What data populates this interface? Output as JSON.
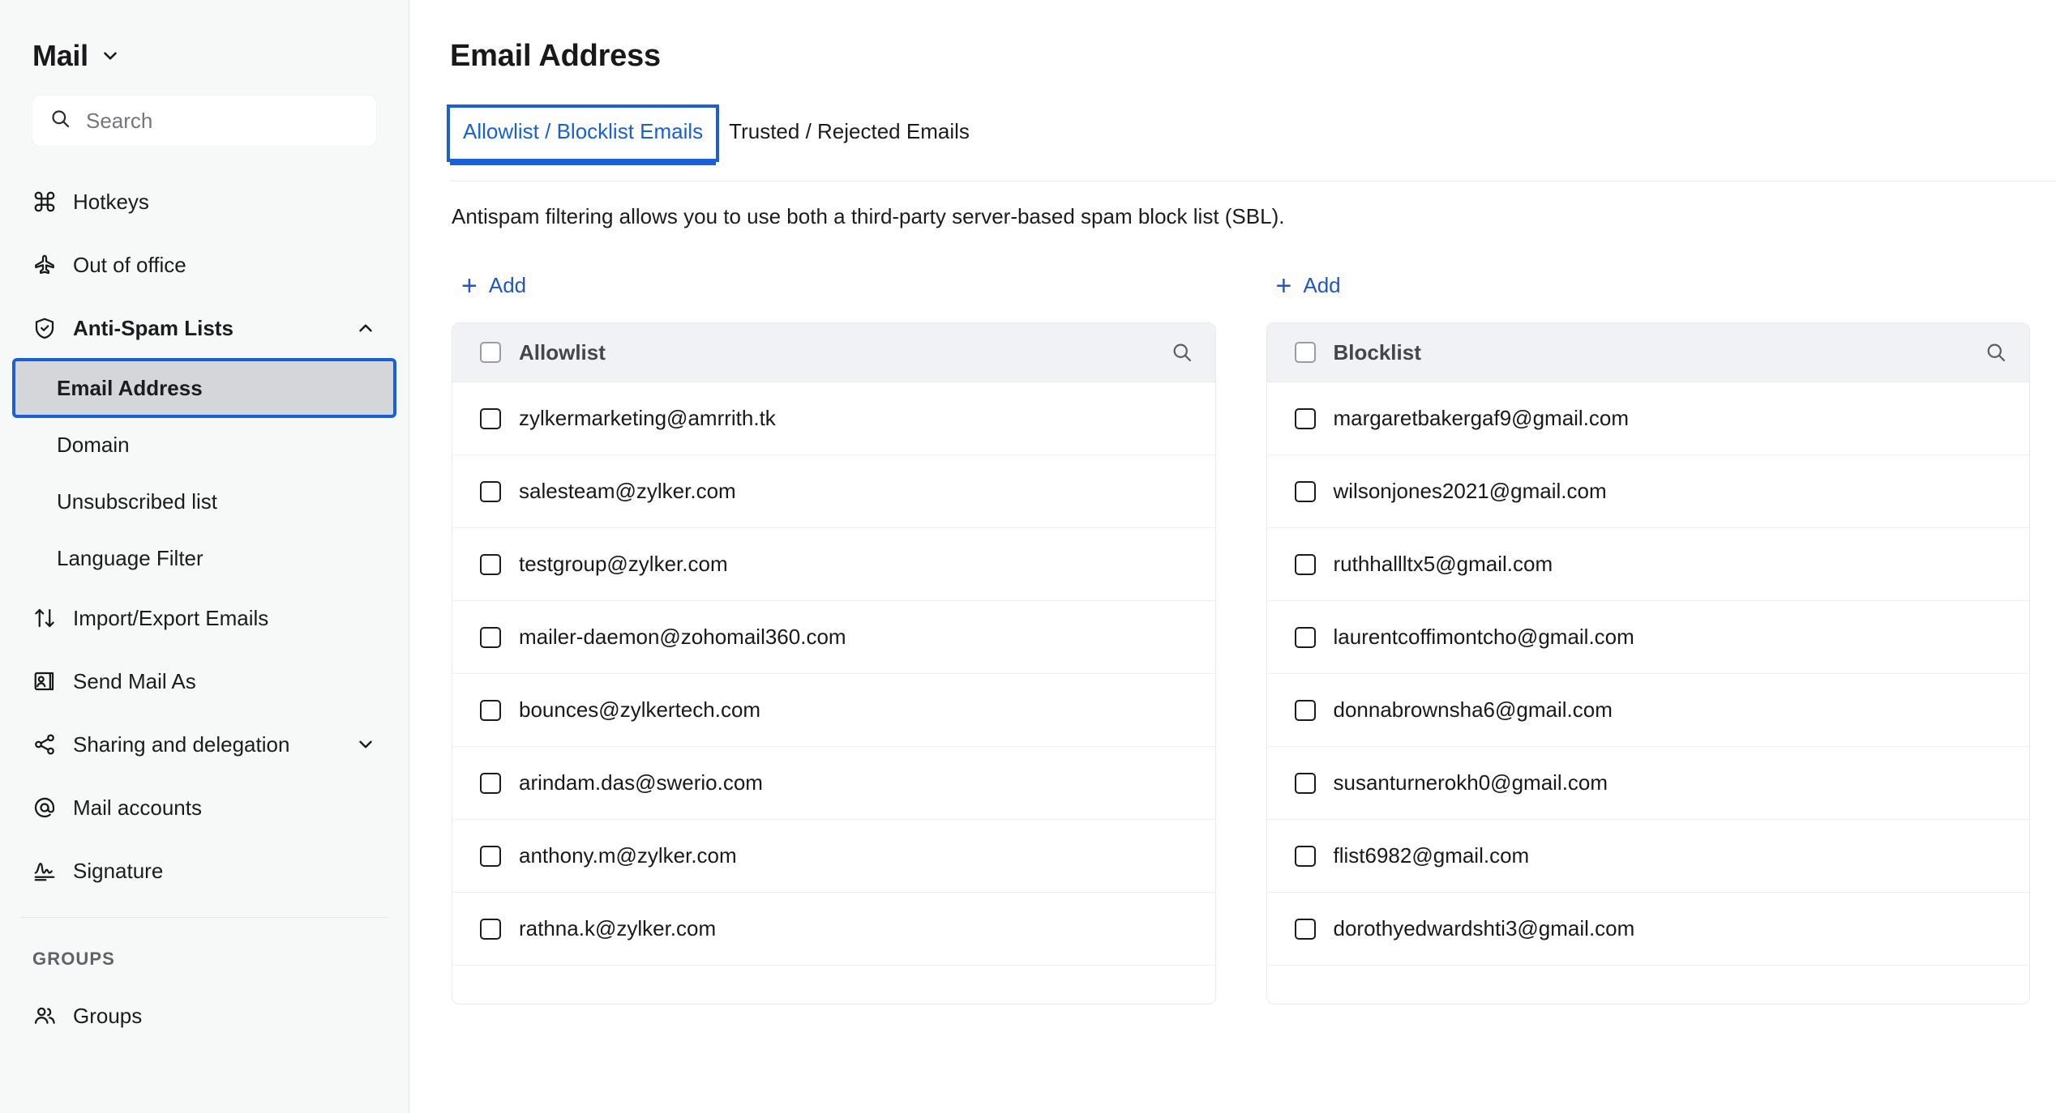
{
  "sidebar": {
    "brand": "Mail",
    "brand_caret_icon": "chevron-down-icon",
    "search": {
      "placeholder": "Search",
      "icon": "search-icon"
    },
    "items": [
      {
        "label": "Hotkeys",
        "icon": "command-icon"
      },
      {
        "label": "Out of office",
        "icon": "airplane-icon"
      },
      {
        "label": "Anti-Spam Lists",
        "icon": "shield-check-icon",
        "caret": "chevron-up-icon",
        "expanded": true,
        "bold": true
      },
      {
        "label": "Import/Export Emails",
        "icon": "arrows-up-down-icon"
      },
      {
        "label": "Send Mail As",
        "icon": "user-card-icon"
      },
      {
        "label": "Sharing and delegation",
        "icon": "share-nodes-icon",
        "caret": "chevron-down-icon"
      },
      {
        "label": "Mail accounts",
        "icon": "at-sign-icon"
      },
      {
        "label": "Signature",
        "icon": "signature-icon"
      }
    ],
    "sub_items": [
      {
        "label": "Email Address",
        "active": true
      },
      {
        "label": "Domain",
        "active": false
      },
      {
        "label": "Unsubscribed list",
        "active": false
      },
      {
        "label": "Language Filter",
        "active": false
      }
    ],
    "groups_heading": "GROUPS",
    "groups_item": {
      "label": "Groups",
      "icon": "users-icon"
    }
  },
  "main": {
    "page_title": "Email Address",
    "tabs": [
      {
        "label": "Allowlist / Blocklist Emails",
        "active": true
      },
      {
        "label": "Trusted / Rejected Emails",
        "active": false
      }
    ],
    "description": "Antispam filtering allows you to use both a third-party server-based spam block list (SBL).",
    "columns": [
      {
        "add_label": "Add",
        "add_icon": "plus-icon",
        "panel_title": "Allowlist",
        "search_icon": "search-icon",
        "rows": [
          "zylkermarketing@amrrith.tk",
          "salesteam@zylker.com",
          "testgroup@zylker.com",
          "mailer-daemon@zohomail360.com",
          "bounces@zylkertech.com",
          "arindam.das@swerio.com",
          "anthony.m@zylker.com",
          "rathna.k@zylker.com"
        ]
      },
      {
        "add_label": "Add",
        "add_icon": "plus-icon",
        "panel_title": "Blocklist",
        "search_icon": "search-icon",
        "rows": [
          "margaretbakergaf9@gmail.com",
          "wilsonjones2021@gmail.com",
          "ruthhallltx5@gmail.com",
          "laurentcoffimontcho@gmail.com",
          "donnabrownsha6@gmail.com",
          "susanturnerokh0@gmail.com",
          "flist6982@gmail.com",
          "dorothyedwardshti3@gmail.com"
        ]
      }
    ]
  },
  "colors": {
    "accent_blue": "#1a5fd6",
    "link_blue": "#2356c5",
    "sidebar_bg": "#f7f8f8",
    "selected_bg": "#d4d6d9",
    "panel_head_bg": "#f0f2f5"
  }
}
